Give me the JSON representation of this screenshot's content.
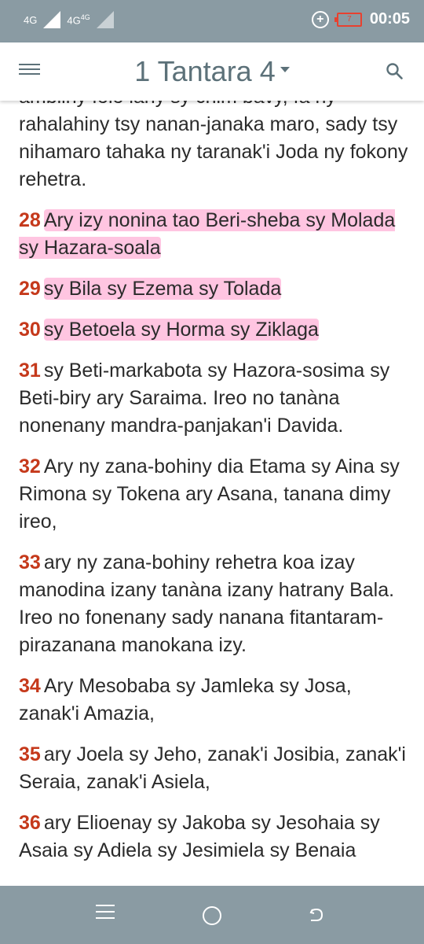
{
  "status_bar": {
    "network_1": "4G",
    "network_2": "4G",
    "network_2_sup": "4G",
    "battery_level": "7",
    "time": "00:05"
  },
  "app_bar": {
    "title": "1 Tantara 4"
  },
  "content": {
    "partial_top_line": "ambiiny folo lany sy chim bavy, fa ny",
    "lead_text": "rahalahiny tsy nanan-janaka maro, sady tsy nihamaro tahaka ny taranak'i Joda ny fokony rehetra.",
    "verses": [
      {
        "num": "28",
        "text": "Ary izy nonina tao Beri-sheba sy Molada sy Hazara-soala",
        "highlighted": true
      },
      {
        "num": "29",
        "text": "sy Bila sy Ezema sy Tolada",
        "highlighted": true
      },
      {
        "num": "30",
        "text": "sy Betoela sy Horma sy Ziklaga",
        "highlighted": true
      },
      {
        "num": "31",
        "text": "sy Beti-markabota sy Hazora-sosima sy Beti-biry ary Saraima. Ireo no tanàna nonenany mandra-panjakan'i Davida.",
        "highlighted": false
      },
      {
        "num": "32",
        "text": "Ary ny zana-bohiny dia Etama sy Aina sy Rimona sy Tokena ary Asana, tanana dimy ireo,",
        "highlighted": false
      },
      {
        "num": "33",
        "text": "ary ny zana-bohiny rehetra koa izay manodina izany tanàna izany hatrany Bala. Ireo no fonenany sady nanana fitantaram-pirazanana manokana izy.",
        "highlighted": false
      },
      {
        "num": "34",
        "text": "Ary Mesobaba sy Jamleka sy Josa, zanak'i Amazia,",
        "highlighted": false
      },
      {
        "num": "35",
        "text": "ary Joela sy Jeho, zanak'i Josibia, zanak'i Seraia, zanak'i Asiela,",
        "highlighted": false
      },
      {
        "num": "36",
        "text": "ary Elioenay sy Jakoba sy Jesohaia sy Asaia sy Adiela sy Jesimiela sy Benaia",
        "highlighted": false
      }
    ]
  },
  "colors": {
    "status_bar": "#8a9ba3",
    "title": "#5c7179",
    "verse_number": "#c5391b",
    "highlight": "#ff96c8",
    "battery_low": "#e8412f"
  },
  "icons": {
    "menu": "hamburger-menu-icon",
    "search": "search-icon",
    "dropdown": "caret-down-icon",
    "nav_recents": "recents-icon",
    "nav_home": "home-icon",
    "nav_back": "back-icon"
  }
}
